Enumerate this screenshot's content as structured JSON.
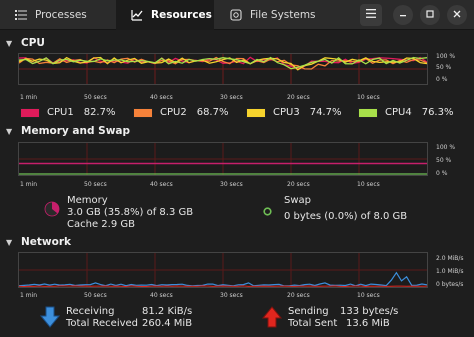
{
  "tabs": [
    {
      "label": "Processes",
      "icon": "list-icon"
    },
    {
      "label": "Resources",
      "icon": "chart-icon"
    },
    {
      "label": "File Systems",
      "icon": "disk-icon"
    }
  ],
  "sections": {
    "cpu": "CPU",
    "memory": "Memory and Swap",
    "network": "Network"
  },
  "time_ticks": [
    "1 min",
    "50 secs",
    "40 secs",
    "30 secs",
    "20 secs",
    "10 secs"
  ],
  "pct_ticks": [
    "100 %",
    "50 %",
    "0 %"
  ],
  "net_ticks": [
    "2.0 MiB/s",
    "1.0 MiB/s",
    "0 bytes/s"
  ],
  "cpus": [
    {
      "name": "CPU1",
      "value": "82.7%",
      "color": "#e01b5b"
    },
    {
      "name": "CPU2",
      "value": "68.7%",
      "color": "#f6823a"
    },
    {
      "name": "CPU3",
      "value": "74.7%",
      "color": "#f6d32d"
    },
    {
      "name": "CPU4",
      "value": "76.3%",
      "color": "#a8e04a"
    }
  ],
  "memory": {
    "label": "Memory",
    "used": "3.0 GB (35.8%) of 8.3 GB",
    "cache": "Cache 2.9 GB",
    "color": "#c61f6b",
    "fraction": 0.358
  },
  "swap": {
    "label": "Swap",
    "used": "0 bytes (0.0%) of 8.0 GB",
    "color": "#6fbf55"
  },
  "network": {
    "receiving_label": "Receiving",
    "receiving": "81.2 KiB/s",
    "total_received_label": "Total Received",
    "total_received": "260.4 MiB",
    "sending_label": "Sending",
    "sending": "133 bytes/s",
    "total_sent_label": "Total Sent",
    "total_sent": "13.6 MiB",
    "receive_color": "#3c8fdc",
    "send_color": "#e0261e"
  }
}
